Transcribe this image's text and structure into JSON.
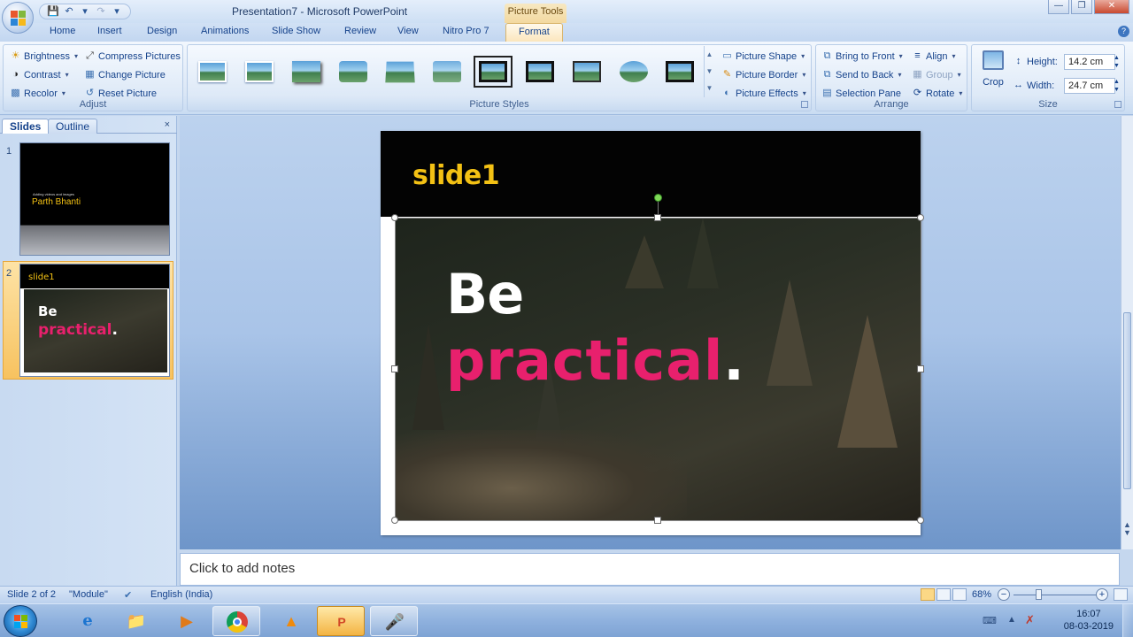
{
  "window": {
    "title": "Presentation7 - Microsoft PowerPoint",
    "contextual_tab_group": "Picture Tools"
  },
  "tabs": [
    "Home",
    "Insert",
    "Design",
    "Animations",
    "Slide Show",
    "Review",
    "View",
    "Nitro Pro 7",
    "Format"
  ],
  "active_tab": "Format",
  "ribbon": {
    "adjust": {
      "brightness": "Brightness",
      "contrast": "Contrast",
      "recolor": "Recolor",
      "compress": "Compress Pictures",
      "change": "Change Picture",
      "reset": "Reset Picture",
      "label": "Adjust"
    },
    "picture_styles": {
      "label": "Picture Styles",
      "shape": "Picture Shape",
      "border": "Picture Border",
      "effects": "Picture Effects"
    },
    "arrange": {
      "bring_to_front": "Bring to Front",
      "send_to_back": "Send to Back",
      "selection_pane": "Selection Pane",
      "align": "Align",
      "group": "Group",
      "rotate": "Rotate",
      "label": "Arrange"
    },
    "size": {
      "crop": "Crop",
      "height_label": "Height:",
      "height_value": "14.2 cm",
      "width_label": "Width:",
      "width_value": "24.7 cm",
      "label": "Size"
    }
  },
  "pane": {
    "tabs": [
      "Slides",
      "Outline"
    ],
    "close": "×",
    "slides": [
      {
        "num": "1",
        "small_text": "Adding videos and images",
        "name": "Parth Bhanti"
      },
      {
        "num": "2",
        "title": "slide1",
        "line1": "Be",
        "line2": "practical",
        "dot": "."
      }
    ]
  },
  "slide": {
    "title": "slide1",
    "headline_1": "Be",
    "headline_2": "practical",
    "headline_dot": "."
  },
  "notes": {
    "placeholder": "Click to add notes"
  },
  "status": {
    "slide_info": "Slide 2 of 2",
    "theme": "\"Module\"",
    "language": "English (India)",
    "zoom": "68%",
    "zoom_fraction": 0.27
  },
  "taskbar": {
    "time": "16:07",
    "date": "08-03-2019"
  },
  "colors": {
    "slide_title": "#f3c114",
    "headline_pink": "#e8206d",
    "ribbon_accent": "#15428b"
  }
}
